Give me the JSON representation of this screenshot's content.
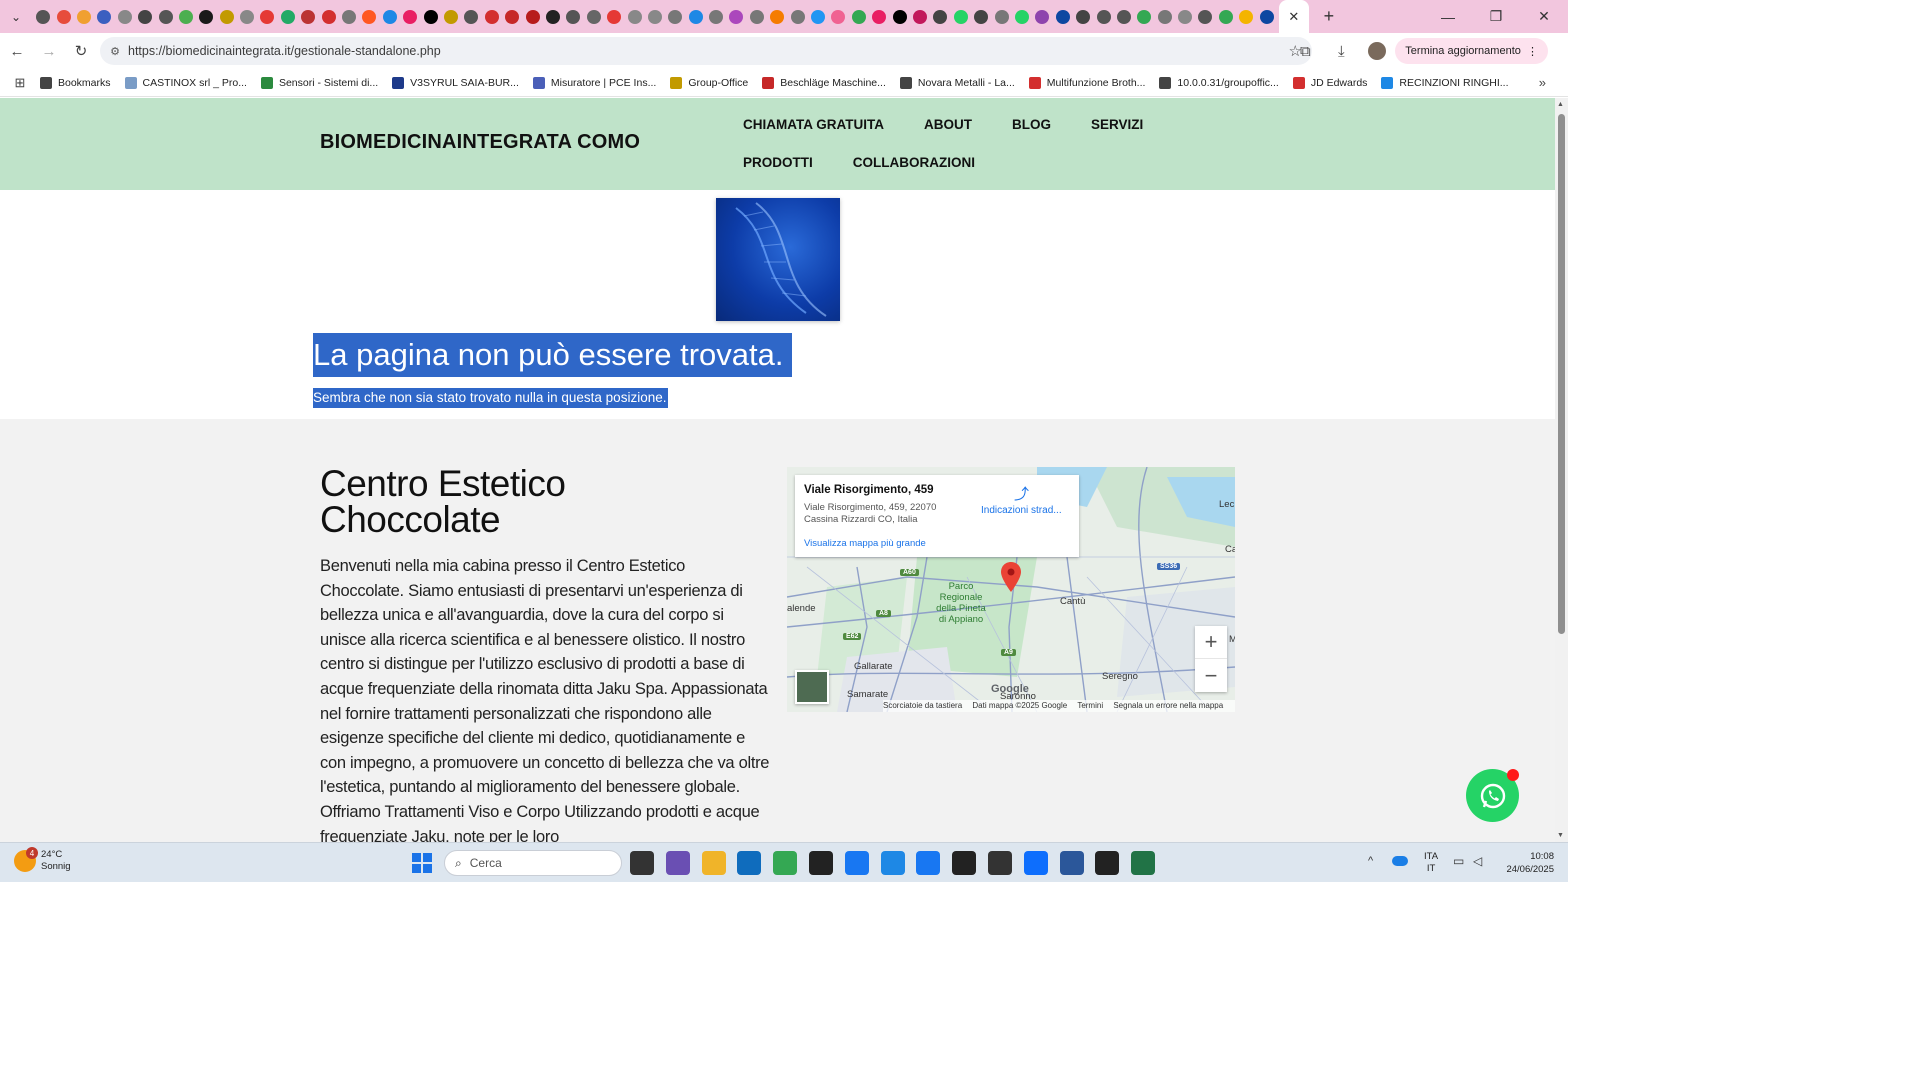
{
  "browser": {
    "tab_strip_colors": [
      "#555",
      "#e74c3c",
      "#f0a030",
      "#3b5fc0",
      "#888",
      "#444",
      "#555",
      "#4caf50",
      "#1a1a1a",
      "#c29a00",
      "#888",
      "#e53935",
      "#2a6",
      "#b33",
      "#d32f2f",
      "#777",
      "#ff5722",
      "#1e88e5",
      "#e91e63",
      "#000",
      "#c29a00",
      "#555",
      "#d32f2f",
      "#c62828",
      "#b71c1c",
      "#222",
      "#555",
      "#666",
      "#e53935",
      "#888",
      "#888",
      "#777",
      "#1e88e5",
      "#777",
      "#ab47bc",
      "#777",
      "#f57c00",
      "#777",
      "#2196f3",
      "#f06292",
      "#34a853",
      "#e91e63",
      "#000",
      "#c2185b",
      "#444",
      "#25d366",
      "#444",
      "#777",
      "#25d366",
      "#8e44ad",
      "#0d47a1",
      "#444",
      "#555",
      "#555",
      "#34a853",
      "#777",
      "#888",
      "#555",
      "#34a853",
      "#f4b400",
      "#0d47a1"
    ],
    "url": "https://biomedicinaintegrata.it/gestionale-standalone.php",
    "update_button": "Termina aggiornamento",
    "bookmarks": [
      {
        "label": "Bookmarks",
        "color": "#444"
      },
      {
        "label": "CASTINOX srl _ Pro...",
        "color": "#7a9cc6"
      },
      {
        "label": "Sensori - Sistemi di...",
        "color": "#2b8a3e"
      },
      {
        "label": "V3SYRUL SAIA-BUR...",
        "color": "#1e3a8a"
      },
      {
        "label": "Misuratore | PCE Ins...",
        "color": "#4b5fb8"
      },
      {
        "label": "Group-Office",
        "color": "#c29a00"
      },
      {
        "label": "Beschläge Maschine...",
        "color": "#c62828"
      },
      {
        "label": "Novara Metalli - La...",
        "color": "#444"
      },
      {
        "label": "Multifunzione Broth...",
        "color": "#d32f2f"
      },
      {
        "label": "10.0.0.31/groupoffic...",
        "color": "#444"
      },
      {
        "label": "JD Edwards",
        "color": "#d32f2f"
      },
      {
        "label": "RECINZIONI RINGHI...",
        "color": "#1e88e5"
      }
    ]
  },
  "site": {
    "title": "BIOMEDICINAINTEGRATA COMO",
    "nav": [
      "CHIAMATA GRATUITA",
      "ABOUT",
      "BLOG",
      "SERVIZI",
      "PRODOTTI",
      "COLLABORAZIONI"
    ],
    "error_title": "La pagina non può essere trovata.",
    "error_subtitle": "Sembra che non sia stato trovato nulla in questa posizione.",
    "section_title": "Centro Estetico Choccolate",
    "section_body": "Benvenuti nella mia cabina presso il Centro Estetico Choccolate. Siamo entusiasti di presentarvi un'esperienza di bellezza unica e all'avanguardia, dove la cura del corpo si unisce alla ricerca scientifica e al benessere olistico. Il nostro centro si distingue per l'utilizzo esclusivo di prodotti a base di acque frequenziate della rinomata ditta Jaku Spa. Appassionata nel fornire trattamenti personalizzati che rispondono alle esigenze specifiche del cliente mi dedico, quotidianamente e con impegno, a promuovere un concetto di bellezza che va oltre l'estetica, puntando al miglioramento del benessere globale. Offriamo Trattamenti Viso e Corpo Utilizzando prodotti e acque frequenziate Jaku, note per le loro",
    "header_color": "#bfe3c9",
    "highlight_color": "#2f67c8"
  },
  "map": {
    "card_title": "Viale Risorgimento, 459",
    "card_address_1": "Viale Risorgimento, 459, 22070",
    "card_address_2": "Cassina Rizzardi CO, Italia",
    "directions": "Indicazioni strad...",
    "larger_map": "Visualizza mappa più grande",
    "zoom_in": "+",
    "zoom_out": "−",
    "footer": [
      "Scorciatoie da tastiera",
      "Dati mappa ©2025 Google",
      "Termini",
      "Segnala un errore nella mappa"
    ],
    "logo": "Google",
    "places": [
      {
        "name": "Parco\nRegionale\ndella Pineta\ndi Appiano"
      },
      {
        "name": "Cantù"
      },
      {
        "name": "Gallarate"
      },
      {
        "name": "Samarate"
      },
      {
        "name": "Seregno"
      },
      {
        "name": "Saronno"
      },
      {
        "name": "alende"
      },
      {
        "name": "Lec"
      },
      {
        "name": "Ca"
      },
      {
        "name": "M"
      }
    ],
    "roads": [
      "A60",
      "SS36",
      "A8",
      "E62",
      "A9"
    ]
  },
  "taskbar": {
    "weather_badge": "4",
    "weather_temp": "24°C",
    "weather_desc": "Sonnig",
    "search_placeholder": "Cerca",
    "lang_1": "ITA",
    "lang_2": "IT",
    "time": "10:08",
    "date": "24/06/2025",
    "apps": [
      {
        "name": "task-view-icon",
        "color": "#333"
      },
      {
        "name": "widgets-icon",
        "color": "#6a4fb3"
      },
      {
        "name": "file-explorer-icon",
        "color": "#f0b429"
      },
      {
        "name": "outlook-icon",
        "color": "#0f6cbd"
      },
      {
        "name": "chrome-icon",
        "color": "#34a853"
      },
      {
        "name": "amazon-icon",
        "color": "#222"
      },
      {
        "name": "facebook-icon",
        "color": "#1877f2"
      },
      {
        "name": "search-app-icon",
        "color": "#1e88e5"
      },
      {
        "name": "facebook-2-icon",
        "color": "#1877f2"
      },
      {
        "name": "store-icon",
        "color": "#222"
      },
      {
        "name": "media-icon",
        "color": "#333"
      },
      {
        "name": "app-blue-icon",
        "color": "#0d6efd"
      },
      {
        "name": "word-icon",
        "color": "#2b579a"
      },
      {
        "name": "terminal-icon",
        "color": "#222"
      },
      {
        "name": "excel-like-icon",
        "color": "#217346"
      }
    ]
  }
}
